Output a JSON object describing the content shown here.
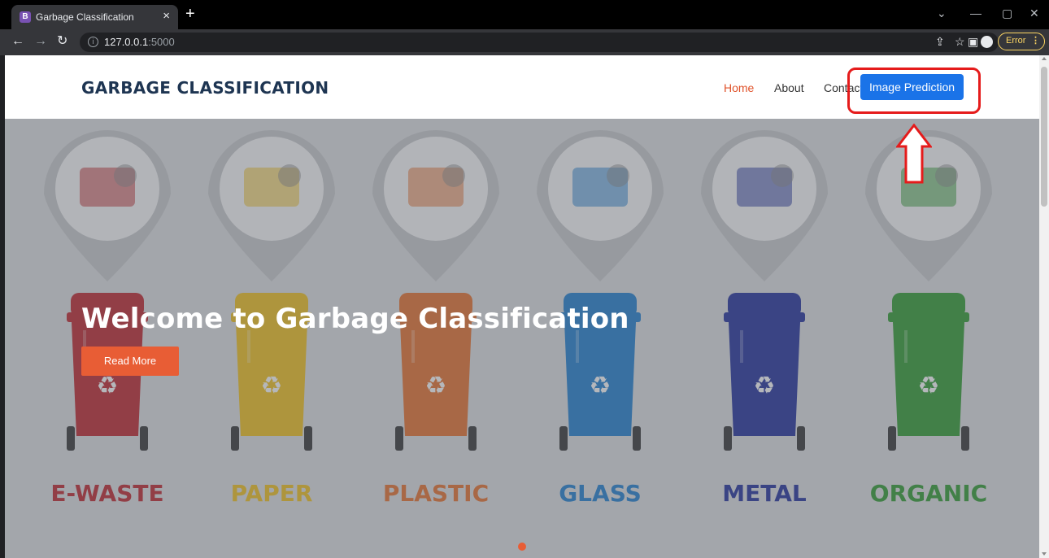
{
  "browser": {
    "tab_title": "Garbage Classification",
    "tab_favicon": "B",
    "url_host": "127.0.0.1",
    "url_port": ":5000",
    "error_label": "Error",
    "icons": [
      "back-icon",
      "forward-icon",
      "reload-icon",
      "info-icon",
      "share-icon",
      "star-icon",
      "sidepanel-icon",
      "profile-icon",
      "menu-icon"
    ]
  },
  "header": {
    "logo": "GARBAGE CLASSIFICATION",
    "nav": {
      "home": "Home",
      "about": "About",
      "contact": "Contact",
      "predict": "Image Prediction"
    }
  },
  "hero": {
    "title": "Welcome to Garbage Classification",
    "button": "Read More",
    "categories": [
      {
        "label": "E-WASTE",
        "color": "#c0242a"
      },
      {
        "label": "PAPER",
        "color": "#f2c11b"
      },
      {
        "label": "PLASTIC",
        "color": "#e8702a"
      },
      {
        "label": "GLASS",
        "color": "#1e7fd0"
      },
      {
        "label": "METAL",
        "color": "#1f2e9b"
      },
      {
        "label": "ORGANIC",
        "color": "#2e9b2e"
      }
    ]
  },
  "colors": {
    "accent": "#e85d35",
    "primary": "#1a73e8",
    "annotation": "#e51b1b"
  }
}
